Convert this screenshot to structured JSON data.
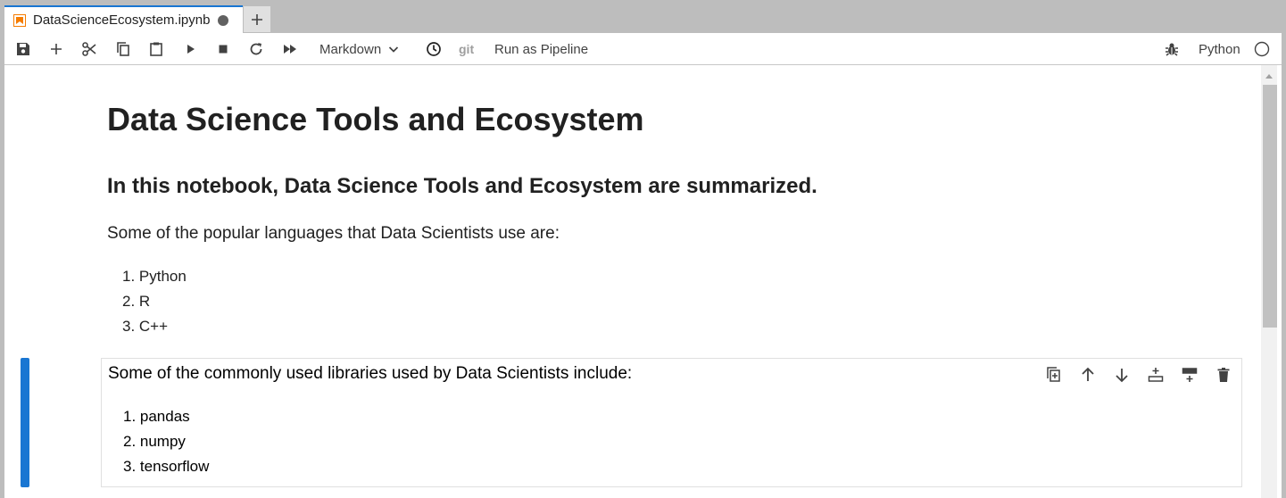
{
  "tab": {
    "title": "DataScienceEcosystem.ipynb"
  },
  "toolbar": {
    "cell_type": "Markdown",
    "git_label": "git",
    "pipeline_label": "Run as Pipeline",
    "kernel_name": "Python"
  },
  "cell1": {
    "title": "Data Science Tools and Ecosystem",
    "subtitle": "In this notebook, Data Science Tools and Ecosystem are summarized.",
    "intro": "Some of the popular languages that Data Scientists use are:",
    "items": [
      "1. Python",
      "2. R",
      "3. C++"
    ]
  },
  "cell2": {
    "intro": "Some of the commonly used libraries used by Data Scientists include:",
    "items": [
      "1. pandas",
      "2. numpy",
      "3. tensorflow"
    ]
  },
  "colors": {
    "accent": "#1976d2",
    "tab_icon": "#f57c00"
  }
}
